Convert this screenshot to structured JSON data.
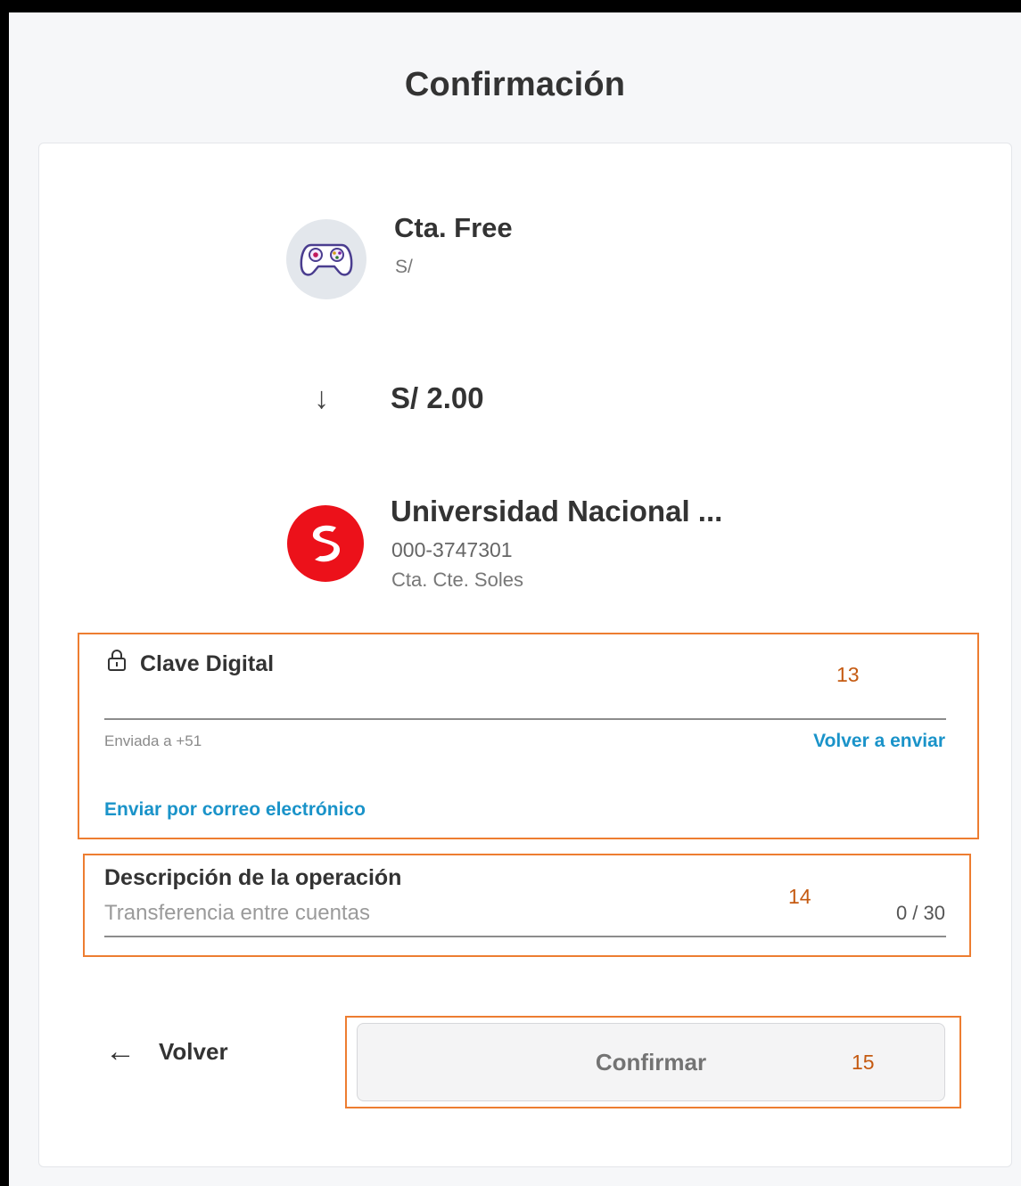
{
  "page": {
    "title": "Confirmación"
  },
  "origin": {
    "name": "Cta. Free",
    "currency": "S/",
    "icon": "gamepad-icon"
  },
  "transfer": {
    "arrow": "↓",
    "amount": "S/ 2.00"
  },
  "destination": {
    "name": "Universidad Nacional ...",
    "account_number": "000-3747301",
    "account_type": "Cta. Cte. Soles",
    "icon": "bank-logo-icon",
    "brand_color": "#ec111a"
  },
  "digital_key": {
    "label": "Clave Digital",
    "value": "",
    "sent_to": "Enviada a +51",
    "resend_label": "Volver a enviar",
    "email_label": "Enviar por correo electrónico"
  },
  "description": {
    "label": "Descripción de la operación",
    "placeholder": "Transferencia entre cuentas",
    "value": "",
    "counter": "0 / 30"
  },
  "actions": {
    "back_arrow": "←",
    "back_label": "Volver",
    "confirm_label": "Confirmar"
  },
  "annotations": {
    "box_13": "13",
    "box_14": "14",
    "box_15": "15",
    "color": "#ed7d31"
  },
  "colors": {
    "link": "#1a93c9",
    "background": "#f6f7f9",
    "card": "#ffffff"
  }
}
